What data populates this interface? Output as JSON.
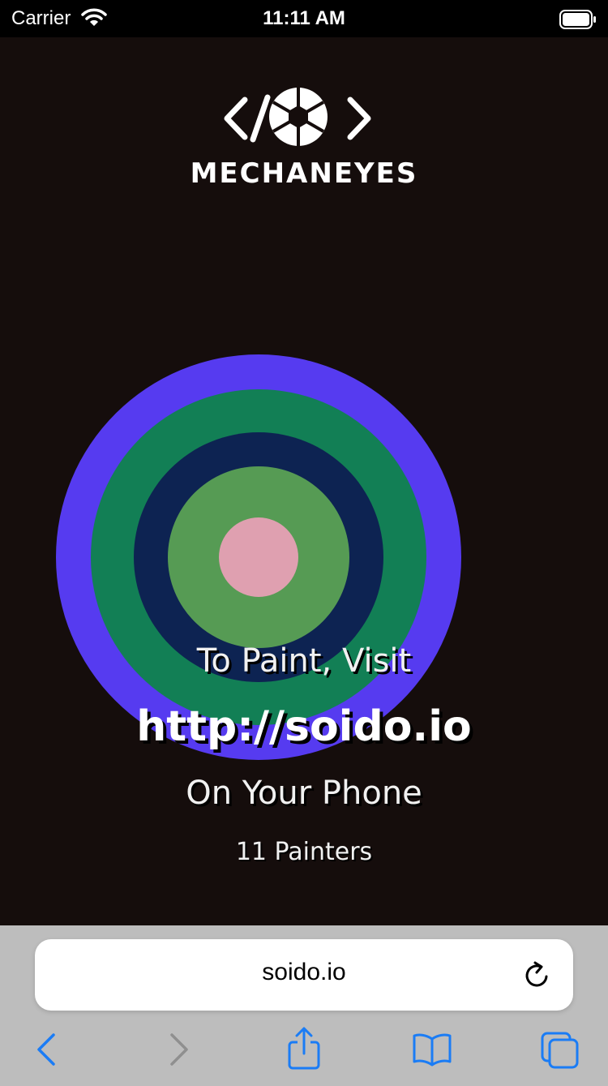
{
  "status_bar": {
    "carrier": "Carrier",
    "time": "11:11 AM",
    "icons": [
      "wifi-icon",
      "battery-icon"
    ]
  },
  "brand": {
    "logo_text": "MECHANEYES",
    "icon": "code-aperture-logo"
  },
  "target_colors": [
    "#563bf0",
    "#127f55",
    "#0d2352",
    "#569b54",
    "#dfa0b0"
  ],
  "overlay": {
    "line1": "To Paint, Visit",
    "url": "http://soido.io",
    "line3": "On Your Phone",
    "painters": "11 Painters"
  },
  "browser": {
    "address": "soido.io",
    "toolbar_icons": [
      "back-icon",
      "forward-icon",
      "share-icon",
      "bookmarks-icon",
      "tabs-icon"
    ],
    "accent": "#1a7cf5"
  }
}
